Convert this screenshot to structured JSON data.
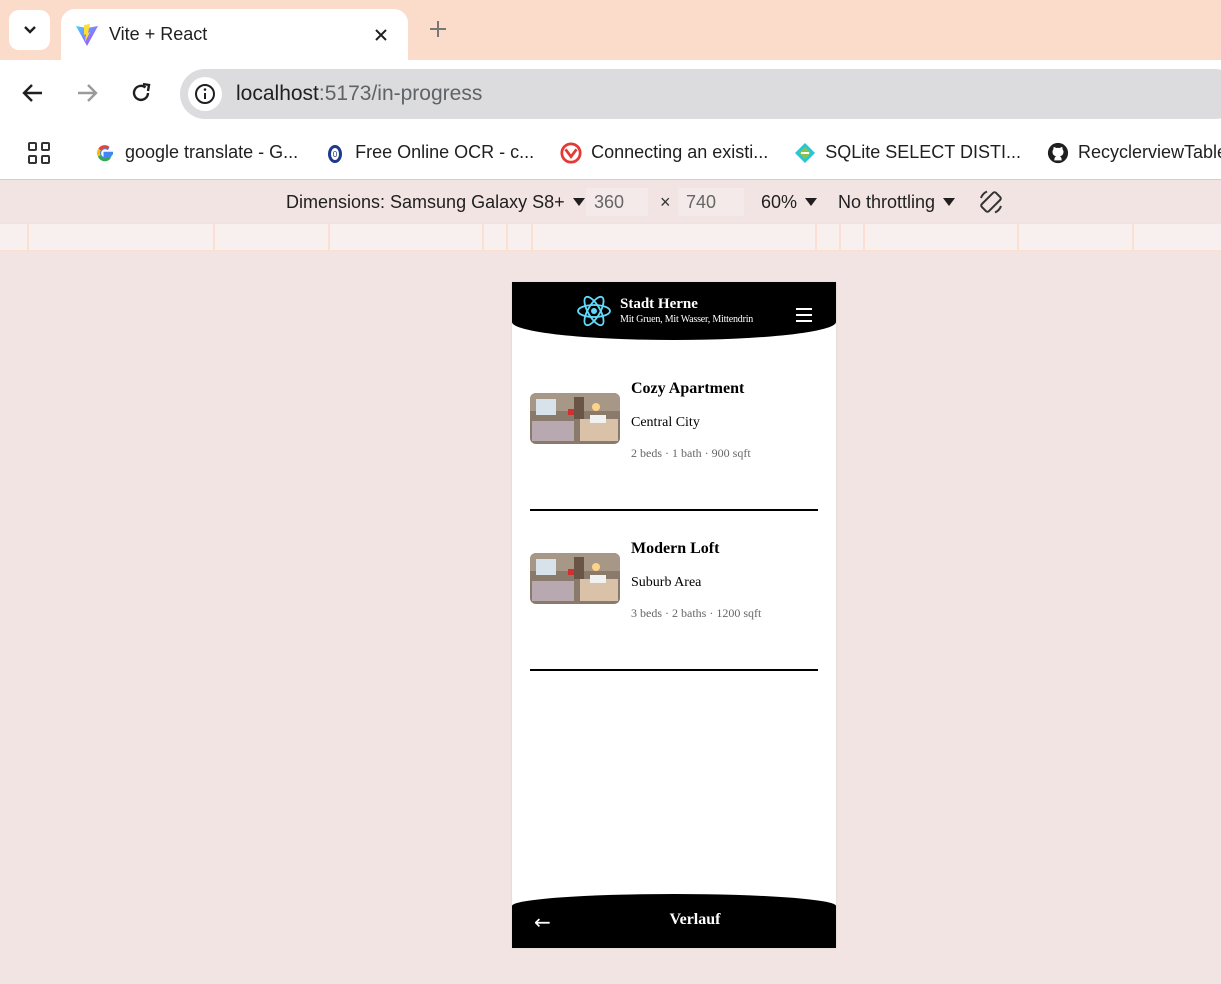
{
  "browser": {
    "tab_title": "Vite + React",
    "url_host": "localhost",
    "url_path": ":5173/in-progress",
    "bookmarks": [
      {
        "label": "google translate - G...",
        "icon": "google-icon"
      },
      {
        "label": "Free Online OCR - c...",
        "icon": "ocr-icon"
      },
      {
        "label": "Connecting an existi...",
        "icon": "red-logo-icon"
      },
      {
        "label": "SQLite SELECT DISTI...",
        "icon": "sqlite-icon"
      },
      {
        "label": "RecyclerviewTableVi...",
        "icon": "github-icon"
      }
    ]
  },
  "devtools": {
    "dimensions_label": "Dimensions: Samsung Galaxy S8+",
    "width": "360",
    "height": "740",
    "times": "×",
    "zoom": "60%",
    "throttling": "No throttling"
  },
  "app": {
    "title": "Stadt Herne",
    "subtitle": "Mit Gruen, Mit Wasser, Mittendrin",
    "listings": [
      {
        "title": "Cozy Apartment",
        "location": "Central City",
        "meta": "2 beds · 1 bath · 900 sqft"
      },
      {
        "title": "Modern Loft",
        "location": "Suburb Area",
        "meta": "3 beds · 2 baths · 1200 sqft"
      }
    ],
    "footer_title": "Verlauf",
    "back_arrow": "←"
  },
  "colors": {
    "tabstrip": "#fbdbc9",
    "page_bg": "#f2e4e2",
    "header_bg": "#000000",
    "react_blue": "#61dafb"
  }
}
